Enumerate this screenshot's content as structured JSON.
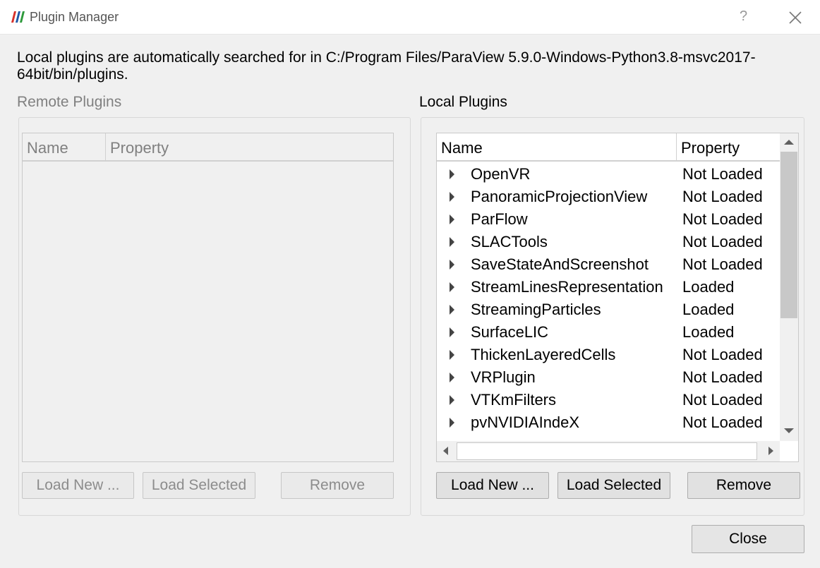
{
  "window": {
    "title": "Plugin Manager",
    "help_glyph": "?",
    "close_icon": "close-icon",
    "app_icon": "paraview-logo-icon",
    "accent_colors": [
      "#d6312a",
      "#1f58a6",
      "#2e9a3c"
    ]
  },
  "info_text": "Local plugins are automatically searched for in C:/Program Files/ParaView 5.9.0-Windows-Python3.8-msvc2017-64bit/bin/plugins.",
  "remote": {
    "label": "Remote Plugins",
    "columns": [
      "Name",
      "Property"
    ],
    "rows": [],
    "buttons": {
      "load_new": "Load New ...",
      "load_selected": "Load Selected",
      "remove": "Remove"
    }
  },
  "local": {
    "label": "Local Plugins",
    "columns": [
      "Name",
      "Property"
    ],
    "rows": [
      {
        "name": "OpenVR",
        "property": "Not Loaded"
      },
      {
        "name": "PanoramicProjectionView",
        "property": "Not Loaded"
      },
      {
        "name": "ParFlow",
        "property": "Not Loaded"
      },
      {
        "name": "SLACTools",
        "property": "Not Loaded"
      },
      {
        "name": "SaveStateAndScreenshot",
        "property": "Not Loaded"
      },
      {
        "name": "StreamLinesRepresentation",
        "property": "Loaded"
      },
      {
        "name": "StreamingParticles",
        "property": "Loaded"
      },
      {
        "name": "SurfaceLIC",
        "property": "Loaded"
      },
      {
        "name": "ThickenLayeredCells",
        "property": "Not Loaded"
      },
      {
        "name": "VRPlugin",
        "property": "Not Loaded"
      },
      {
        "name": "VTKmFilters",
        "property": "Not Loaded"
      },
      {
        "name": "pvNVIDIAIndeX",
        "property": "Not Loaded"
      }
    ],
    "buttons": {
      "load_new": "Load New ...",
      "load_selected": "Load Selected",
      "remove": "Remove"
    }
  },
  "close_label": "Close"
}
